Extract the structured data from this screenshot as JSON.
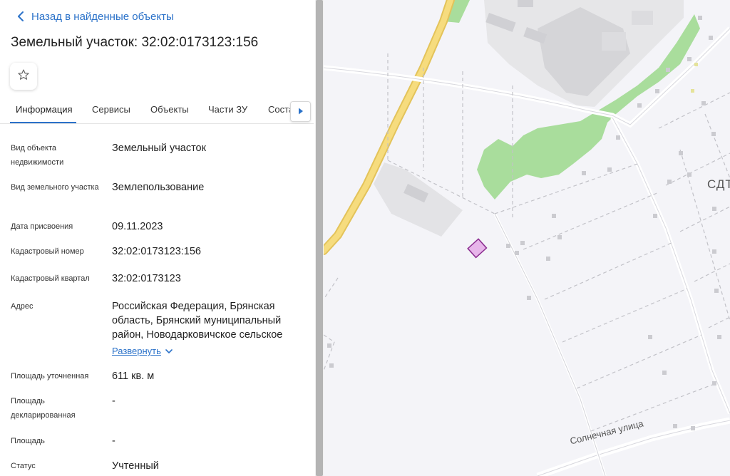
{
  "nav": {
    "back_label": "Назад в найденные объекты",
    "back_icon": "chevron-left-icon"
  },
  "title": "Земельный участок: 32:02:0173123:156",
  "favorite_icon": "star-icon",
  "tabs": [
    {
      "label": "Информация",
      "active": true
    },
    {
      "label": "Сервисы",
      "active": false
    },
    {
      "label": "Объекты",
      "active": false
    },
    {
      "label": "Части ЗУ",
      "active": false
    },
    {
      "label": "Соста",
      "active": false
    }
  ],
  "tab_scroll_icon": "chevron-right-icon",
  "fields": [
    {
      "label": "Вид объекта недвижимости",
      "value": "Земельный участок"
    },
    {
      "label": "Вид земельного участка",
      "value": "Землепользование"
    },
    {
      "label": "Дата присвоения",
      "value": "09.11.2023"
    },
    {
      "label": "Кадастровый номер",
      "value": "32:02:0173123:156"
    },
    {
      "label": "Кадастровый квартал",
      "value": "32:02:0173123"
    },
    {
      "label": "Адрес",
      "value": "Российская Федерация, Брянская область, Брянский муниципальный район, Новодарковичское сельское",
      "expand_label": "Развернуть"
    },
    {
      "label": "Площадь уточненная",
      "value": "611 кв. м"
    },
    {
      "label": "Площадь декларированная",
      "value": "-"
    },
    {
      "label": "Площадь",
      "value": "-"
    },
    {
      "label": "Статус",
      "value": "Учтенный"
    }
  ],
  "map": {
    "street_label": "Солнечная улица",
    "area_label": "СДТ",
    "colors": {
      "background": "#f4f4f8",
      "road_major": "#f2d36b",
      "greenery": "#a9dd9c",
      "building": "#d9d9d9",
      "parcel_fill": "#e7b5ea",
      "parcel_stroke": "#8a2b8f"
    }
  },
  "colors": {
    "accent": "#2b72c9"
  }
}
